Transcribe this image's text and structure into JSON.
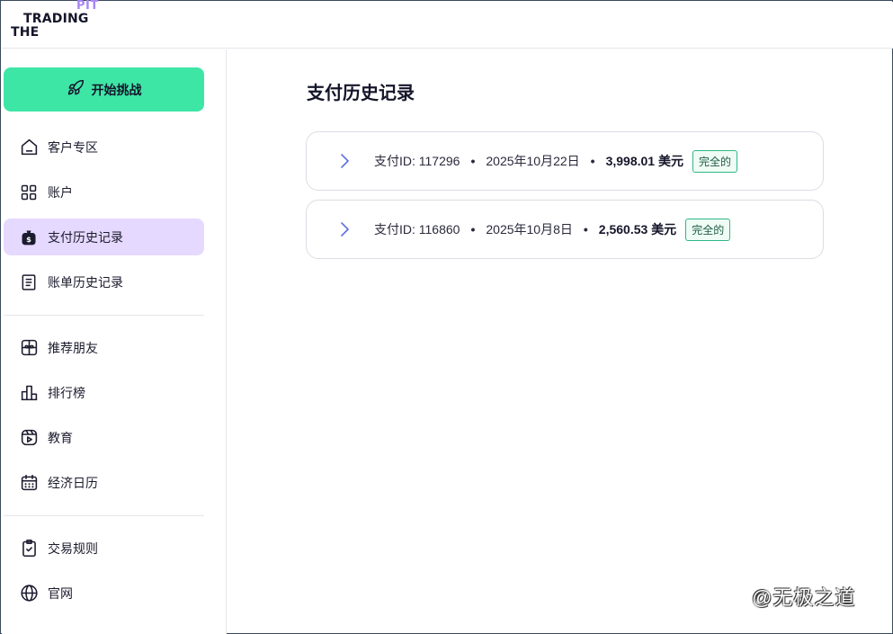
{
  "logo": {
    "line1": "PIT",
    "line2": "TRADING",
    "line3": "THE"
  },
  "sidebar": {
    "cta_label": "开始挑战",
    "items": [
      {
        "label": "客户专区",
        "icon": "home-icon"
      },
      {
        "label": "账户",
        "icon": "grid-icon"
      },
      {
        "label": "支付历史记录",
        "icon": "payout-bag-icon",
        "active": true
      },
      {
        "label": "账单历史记录",
        "icon": "invoice-icon"
      },
      {
        "label": "推荐朋友",
        "icon": "gift-icon"
      },
      {
        "label": "排行榜",
        "icon": "leaderboard-icon"
      },
      {
        "label": "教育",
        "icon": "education-play-icon"
      },
      {
        "label": "经济日历",
        "icon": "calendar-icon"
      },
      {
        "label": "交易规则",
        "icon": "clipboard-check-icon"
      },
      {
        "label": "官网",
        "icon": "globe-icon"
      }
    ]
  },
  "main": {
    "title": "支付历史记录",
    "payments": [
      {
        "id_label": "支付ID: 117296",
        "date": "2025年10月22日",
        "amount": "3,998.01 美元",
        "status": "完全的"
      },
      {
        "id_label": "支付ID: 116860",
        "date": "2025年10月8日",
        "amount": "2,560.53 美元",
        "status": "完全的"
      }
    ]
  },
  "watermark": "@无极之道",
  "colors": {
    "cta": "#3ee6a6",
    "active_nav": "#e6d9ff",
    "pit_accent": "#a987f5",
    "badge_border": "#2fb887"
  }
}
